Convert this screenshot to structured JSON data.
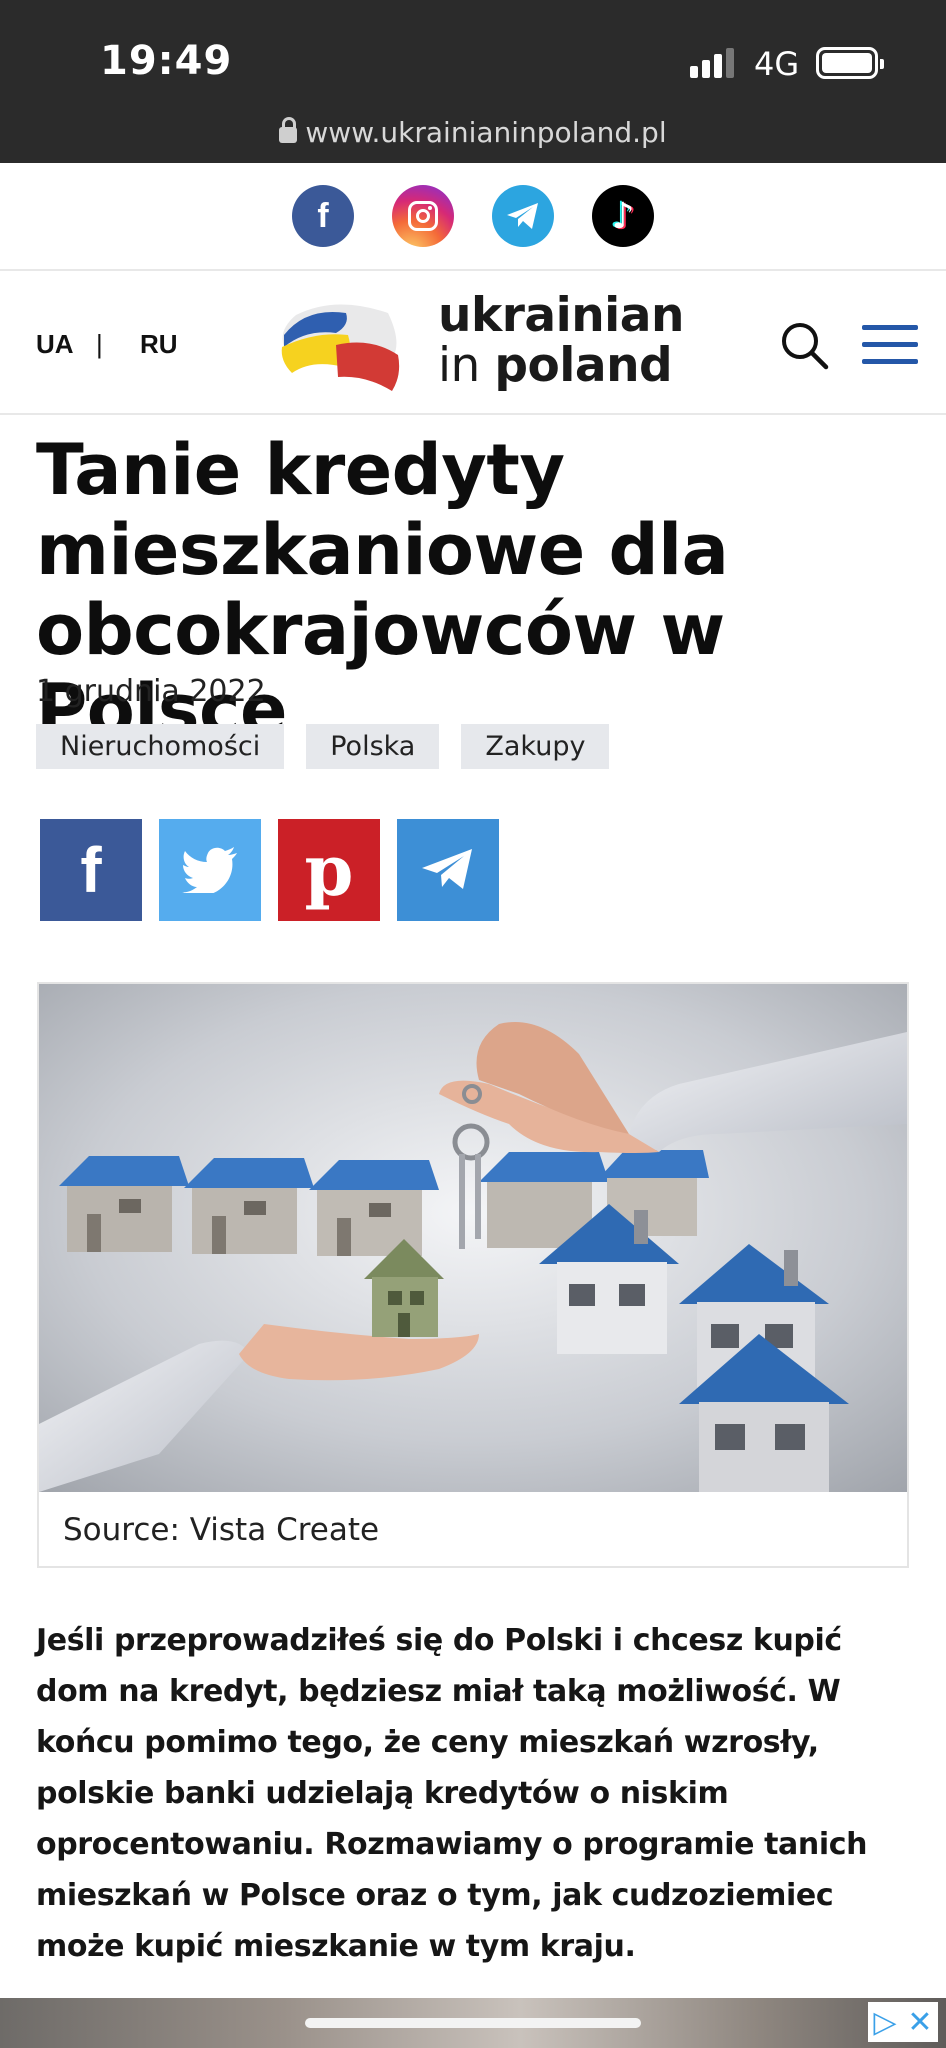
{
  "status_bar": {
    "time": "19:49",
    "network": "4G",
    "signal_bars": 3,
    "battery_level": 1.0
  },
  "browser": {
    "url": "www.ukrainianinpoland.pl"
  },
  "social_links": [
    {
      "name": "facebook-icon",
      "color": "#3b5998"
    },
    {
      "name": "instagram-icon",
      "color": "#d62976"
    },
    {
      "name": "telegram-icon",
      "color": "#2ca5e0"
    },
    {
      "name": "tiktok-icon",
      "color": "#000000"
    }
  ],
  "header": {
    "lang_ua": "UA",
    "lang_separator": "|",
    "lang_ru": "RU",
    "logo_line1": "ukrainian",
    "logo_line2_a": "in",
    "logo_line2_b": "poland",
    "menu_color": "#2457a8"
  },
  "article": {
    "title": "Tanie kredyty mieszkaniowe dla obcokrajowców w Polsce",
    "date": "1 grudnia 2022",
    "tags": [
      "Nieruchomości",
      "Polska",
      "Zakupy"
    ],
    "share_buttons": [
      {
        "name": "share-facebook-button",
        "color": "#3b5998"
      },
      {
        "name": "share-twitter-button",
        "color": "#55acee"
      },
      {
        "name": "share-pinterest-button",
        "color": "#cb2027"
      },
      {
        "name": "share-telegram-button",
        "color": "#3d8fd6"
      }
    ],
    "image_caption": "Source: Vista Create",
    "lead": "Jeśli przeprowadziłeś się do Polski i chcesz kupić dom na kredyt, będziesz miał taką możliwość. W końcu pomimo tego, że ceny mieszkań wzrosły, polskie banki udzielają kredytów o niskim oprocentowaniu. Rozmawiamy o programie tanich mieszkań w Polsce oraz o tym, jak cudzoziemiec może kupić mieszkanie w tym kraju."
  },
  "ad": {
    "icons": [
      "ad-choices-icon",
      "close-icon"
    ]
  }
}
